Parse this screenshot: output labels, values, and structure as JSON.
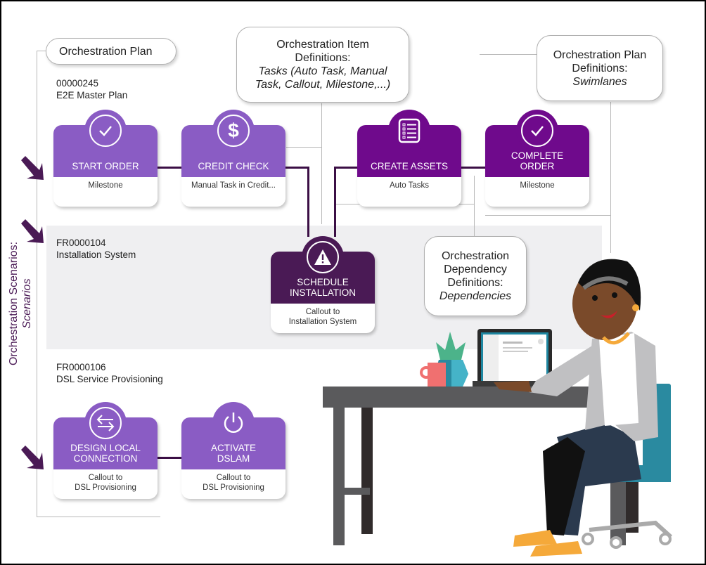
{
  "diagram": {
    "title_vertical": "Orchestration Scenarios:",
    "title_vertical_italic": "Scenarios"
  },
  "callouts": {
    "plan": {
      "title": "Orchestration Plan"
    },
    "item_definitions": {
      "line1": "Orchestration Item",
      "line2": "Definitions:",
      "italic1": "Tasks (Auto Task, Manual",
      "italic2": "Task, Callout, Milestone,...)"
    },
    "plan_definitions": {
      "line1": "Orchestration Plan",
      "line2": "Definitions:",
      "italic": "Swimlanes"
    },
    "dependency_definitions": {
      "line1": "Orchestration",
      "line2": "Dependency",
      "line3": "Definitions:",
      "italic": "Dependencies"
    }
  },
  "lanes": [
    {
      "id": "00000245",
      "name": "E2E Master Plan"
    },
    {
      "id": "FR0000104",
      "name": "Installation System"
    },
    {
      "id": "FR0000106",
      "name": "DSL Service Provisioning"
    }
  ],
  "nodes": [
    {
      "title": "Start Order",
      "subtitle": "Milestone",
      "icon": "check-circle-icon",
      "color": "#8a5cc4"
    },
    {
      "title": "Credit Check",
      "subtitle": "Manual Task in Credit...",
      "icon": "dollar-icon",
      "color": "#8a5cc4"
    },
    {
      "title": "Create Assets",
      "subtitle": "Auto Tasks",
      "icon": "checklist-icon",
      "color": "#6f0a8c"
    },
    {
      "title_line1": "Complete",
      "title_line2": "Order",
      "subtitle": "Milestone",
      "icon": "check-circle-icon",
      "color": "#6f0a8c"
    },
    {
      "title_line1": "Schedule",
      "title_line2": "Installation",
      "subtitle_line1": "Callout to",
      "subtitle_line2": "Installation System",
      "icon": "warning-icon",
      "color": "#4a1a55"
    },
    {
      "title_line1": "Design Local",
      "title_line2": "Connection",
      "subtitle_line1": "Callout to",
      "subtitle_line2": "DSL Provisioning",
      "icon": "swap-arrows-icon",
      "color": "#8a5cc4"
    },
    {
      "title_line1": "Activate",
      "title_line2": "DSLAM",
      "subtitle_line1": "Callout to",
      "subtitle_line2": "DSL Provisioning",
      "icon": "power-icon",
      "color": "#8a5cc4"
    }
  ],
  "colors": {
    "light_purple": "#8a5cc4",
    "dark_purple": "#6f0a8c",
    "deep_purple": "#4a1a55",
    "connector": "#3b0f45",
    "lane_band": "#efeff1"
  }
}
